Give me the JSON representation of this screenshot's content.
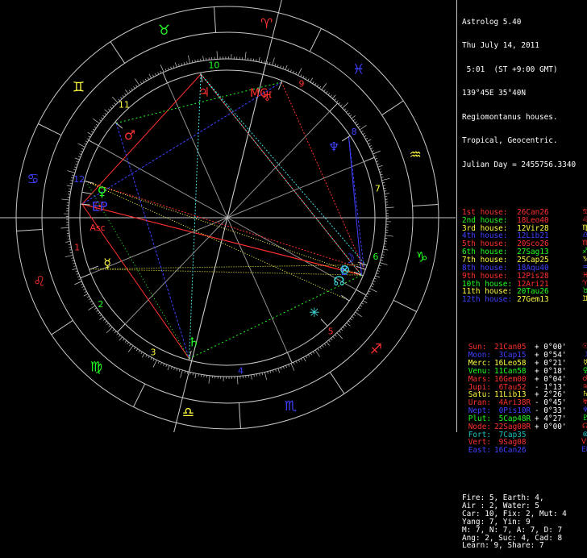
{
  "header": {
    "title": "Astrolog 5.40",
    "date": "Thu July 14, 2011",
    "time": " 5:01  (ST +9:00 GMT)",
    "location": "139°45E 35°40N",
    "house_system": "Regiomontanus houses.",
    "zodiac": "Tropical, Geocentric.",
    "julian_day": "Julian Day = 2455756.3340"
  },
  "houses": [
    {
      "label": "1st house: ",
      "value": "26Can26",
      "color": "#ff3030",
      "glyph": "♋"
    },
    {
      "label": "2nd house: ",
      "value": "18Leo40",
      "color": "#ff3030",
      "glyph": "♌"
    },
    {
      "label": "3rd house: ",
      "value": "12Vir28",
      "color": "#ffff40",
      "glyph": "♍"
    },
    {
      "label": "4th house: ",
      "value": "12Lib21",
      "color": "#4040ff",
      "glyph": "♎"
    },
    {
      "label": "5th house: ",
      "value": "20Sco26",
      "color": "#ff3030",
      "glyph": "♏"
    },
    {
      "label": "6th house: ",
      "value": "27Sag13",
      "color": "#20ff20",
      "glyph": "♐"
    },
    {
      "label": "7th house: ",
      "value": "25Cap25",
      "color": "#ffff40",
      "glyph": "♑"
    },
    {
      "label": "8th house: ",
      "value": "18Aqu40",
      "color": "#4040ff",
      "glyph": "♒"
    },
    {
      "label": "9th house: ",
      "value": "12Pis28",
      "color": "#ff3030",
      "glyph": "♓"
    },
    {
      "label": "10th house:",
      "value": "12Ari21",
      "color": "#ff3030",
      "glyph": "♈"
    },
    {
      "label": "11th house:",
      "value": "20Tau26",
      "color": "#20ff20",
      "glyph": "♉"
    },
    {
      "label": "12th house:",
      "value": "27Gem13",
      "color": "#ffff40",
      "glyph": "♊"
    }
  ],
  "house_label_colors": [
    "#ff3030",
    "#20ff20",
    "#ffff40",
    "#4040ff",
    "#ff3030",
    "#20ff20",
    "#ffff40",
    "#4040ff",
    "#ff3030",
    "#20ff20",
    "#ffff40",
    "#4040ff"
  ],
  "planets": [
    {
      "name": "Sun: ",
      "value": "21Can05",
      "speed": "+ 0°00'",
      "color": "#ff3030",
      "glyph": "☉"
    },
    {
      "name": "Moon:",
      "value": " 3Cap15",
      "speed": "+ 0°54'",
      "color": "#4040ff",
      "glyph": "☽"
    },
    {
      "name": "Merc:",
      "value": "16Leo58",
      "speed": "+ 0°21'",
      "color": "#ffff40",
      "glyph": "☿"
    },
    {
      "name": "Venu:",
      "value": "11Can58",
      "speed": "+ 0°18'",
      "color": "#20ff20",
      "glyph": "♀"
    },
    {
      "name": "Mars:",
      "value": "16Gem00",
      "speed": "+ 0°04'",
      "color": "#ff3030",
      "glyph": "♂"
    },
    {
      "name": "Jupi:",
      "value": " 6Tau52",
      "speed": "- 1°13'",
      "color": "#ff3030",
      "glyph": "♃"
    },
    {
      "name": "Satu:",
      "value": "11Lib13",
      "speed": "+ 2°26'",
      "color": "#ffff40",
      "glyph": "♄"
    },
    {
      "name": "Uran:",
      "value": " 4Ari38R",
      "speed": "- 0°45'",
      "color": "#ff3030",
      "glyph": "♅"
    },
    {
      "name": "Nept:",
      "value": " 0Pis10R",
      "speed": "- 0°33'",
      "color": "#4040ff",
      "glyph": "♆"
    },
    {
      "name": "Plut:",
      "value": " 5Cap48R",
      "speed": "+ 4°27'",
      "color": "#20ff20",
      "glyph": "♇"
    },
    {
      "name": "Node:",
      "value": "22Sag08R",
      "speed": "+ 0°00'",
      "color": "#ff3030",
      "glyph": "☊"
    },
    {
      "name": "Fort:",
      "value": " 7Cap35",
      "speed": "",
      "color": "#20c0c0",
      "glyph": "⊗"
    },
    {
      "name": "Vert:",
      "value": " 9Sag08",
      "speed": "",
      "color": "#ff3030",
      "glyph": "Vx"
    },
    {
      "name": "East:",
      "value": "16Can26",
      "speed": "",
      "color": "#4040ff",
      "glyph": "EP"
    }
  ],
  "planet_name_colors": [
    "#ff3030",
    "#4040ff",
    "#ffff40",
    "#20ff20",
    "#ff3030",
    "#ff3030",
    "#ffff40",
    "#ff3030",
    "#4040ff",
    "#20ff20",
    "#ff3030",
    "#20c0c0",
    "#ff3030",
    "#4040ff"
  ],
  "stats": [
    "Fire: 5, Earth: 4,",
    "Air : 2, Water: 5",
    "Car: 10, Fix: 2, Mut: 4",
    "Yang: 7, Yin: 9",
    "M: 7, N: 7, A: 7, D: 7",
    "Ang: 2, Suc: 4, Cad: 8",
    "Learn: 9, Share: 7"
  ],
  "wheel": {
    "sign_glyphs": [
      "♈",
      "♉",
      "♊",
      "♋",
      "♌",
      "♍",
      "♎",
      "♏",
      "♐",
      "♑",
      "♒",
      "♓"
    ],
    "sign_colors": [
      "#ff3030",
      "#20ff20",
      "#ffff40",
      "#4040ff",
      "#ff3030",
      "#20ff20",
      "#ffff40",
      "#4040ff",
      "#ff3030",
      "#20ff20",
      "#ffff40",
      "#4040ff"
    ],
    "house_numbers": [
      "1",
      "2",
      "3",
      "4",
      "5",
      "6",
      "7",
      "8",
      "9",
      "10",
      "11",
      "12"
    ],
    "asc_label": "Asc",
    "mc_label": "MC",
    "ep_label": "EP",
    "vx_label": "Vx"
  }
}
